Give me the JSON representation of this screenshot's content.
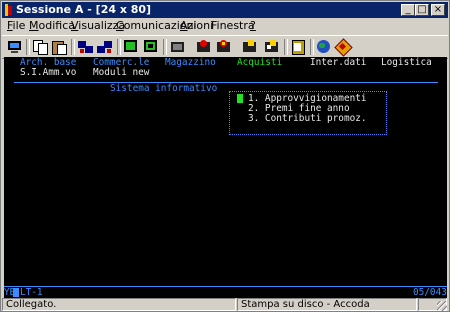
{
  "window": {
    "title": "Sessione A - [24 x 80]",
    "controls": {
      "minimize": "_",
      "maximize": "□",
      "close": "×"
    }
  },
  "menu": {
    "items": [
      {
        "label": "File",
        "accel": "F",
        "rest": "ile"
      },
      {
        "label": "Modifica",
        "accel": "M",
        "rest": "odifica"
      },
      {
        "label": "Visualizza",
        "accel": "V",
        "rest": "isualizza"
      },
      {
        "label": "Comunicazioni",
        "accel": "C",
        "rest": "omunicazioni"
      },
      {
        "label": "Azioni",
        "accel": "A",
        "rest": "zioni"
      },
      {
        "label": "Finestra",
        "accel": "",
        "rest": "Finestra"
      },
      {
        "label": "?",
        "accel": "?",
        "rest": ""
      }
    ]
  },
  "toolbar": {
    "buttons": [
      "print-screen-icon",
      "copy-icon",
      "paste-icon",
      "send-file-icon",
      "receive-file-icon",
      "display-icon",
      "display-alt-icon",
      "macro-icon",
      "record-macro-icon",
      "stop-macro-icon",
      "play-macro-icon",
      "play-alt-icon",
      "clipboard-icon",
      "globe-icon",
      "help-icon"
    ]
  },
  "terminal": {
    "menu_row1": [
      "Arch. base",
      "Commerc.le",
      "Magazzino",
      "Acquisti",
      "Inter.dati",
      "Logistica"
    ],
    "menu_row2": [
      "S.I.Amm.vo",
      "Moduli new"
    ],
    "selected_menu": "Acquisti",
    "section_title": "Sistema informativo",
    "options": [
      "1. Approvvigionamenti",
      "2. Premi fine anno",
      "3. Contributi promoz."
    ],
    "oia_left_prefix": "YB",
    "oia_left_suffix": "LT-1",
    "oia_right": "05/043",
    "colors": {
      "background": "#000000",
      "field": "#3a8cff",
      "selected": "#22e022",
      "text": "#e8e8e8"
    }
  },
  "statusbar": {
    "left": "Collegato.",
    "middle": "Stampa su disco - Accoda",
    "right": ""
  }
}
